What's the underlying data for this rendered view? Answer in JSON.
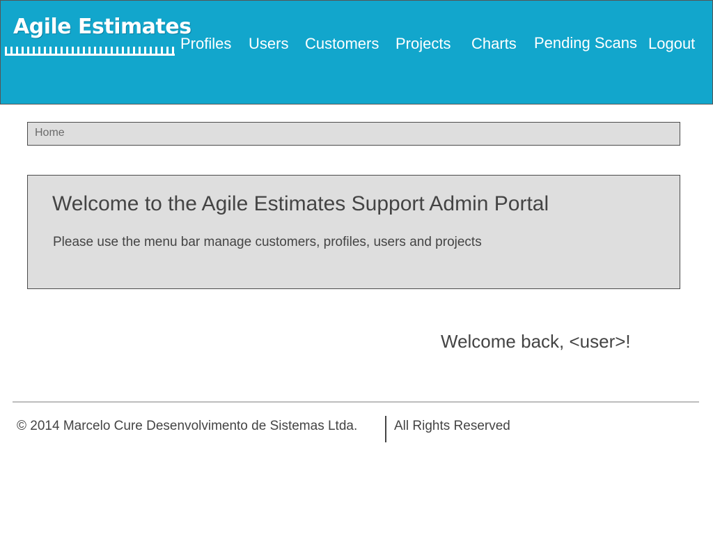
{
  "header": {
    "logo_text": "Agile Estimates",
    "nav": [
      {
        "label": "Profiles"
      },
      {
        "label": "Users"
      },
      {
        "label": "Customers"
      },
      {
        "label": "Projects"
      },
      {
        "label": "Charts"
      },
      {
        "label": "Pending Scans"
      },
      {
        "label": "Logout"
      }
    ]
  },
  "breadcrumb": {
    "home": "Home"
  },
  "welcome_panel": {
    "title": "Welcome to the Agile Estimates Support Admin Portal",
    "text": "Please use the menu bar manage customers, profiles, users and projects"
  },
  "greeting": "Welcome back, <user>!",
  "footer": {
    "copyright": "© 2014 Marcelo Cure Desenvolvimento de Sistemas Ltda.",
    "rights": "All Rights Reserved"
  },
  "colors": {
    "header_bg": "#12a6cc",
    "panel_bg": "#dedede",
    "text": "#444444"
  }
}
